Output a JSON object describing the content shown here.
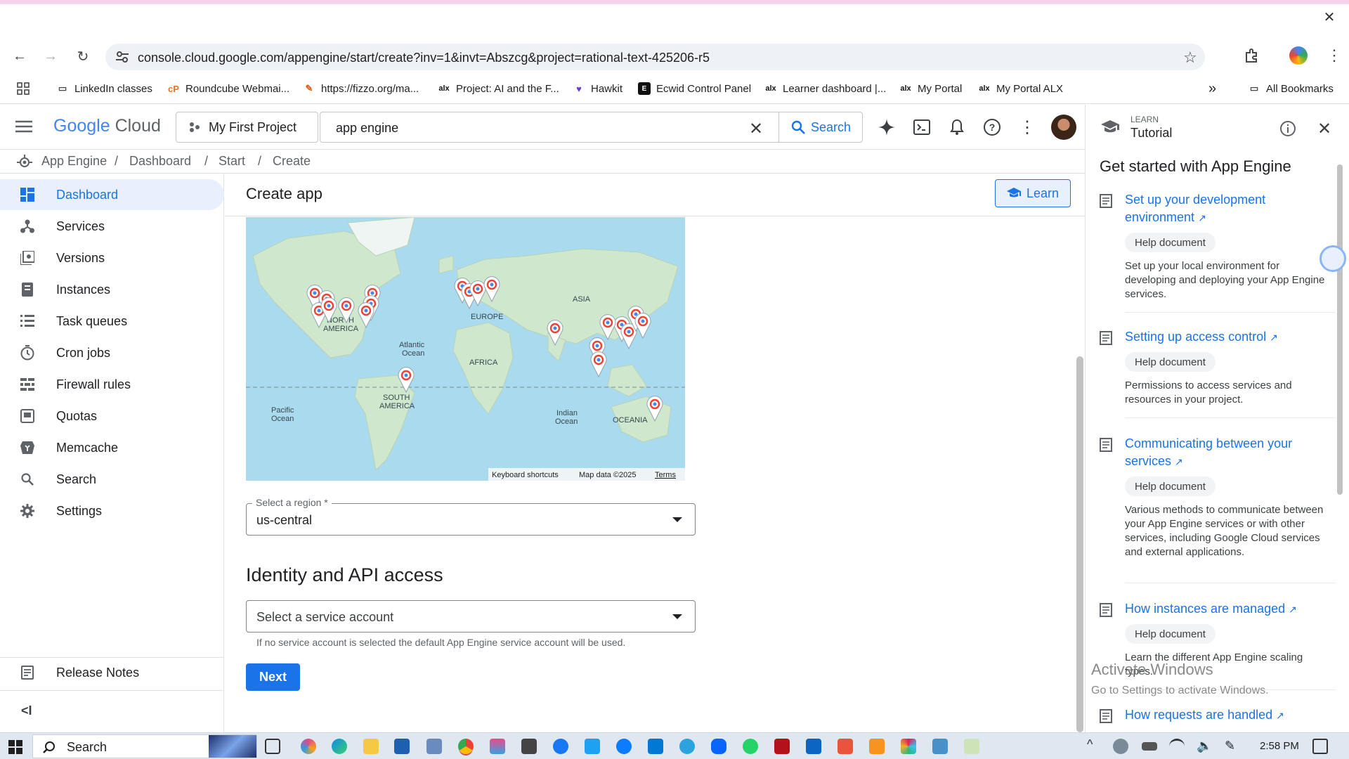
{
  "browser": {
    "url": "console.cloud.google.com/appengine/start/create?inv=1&invt=Abszcg&project=rational-text-425206-r5",
    "bookmarks": [
      {
        "label": "LinkedIn classes",
        "icon": "folder-icon"
      },
      {
        "label": "Roundcube Webmai...",
        "icon": "roundcube-icon"
      },
      {
        "label": "https://fizzo.org/ma...",
        "icon": "fizzo-icon"
      },
      {
        "label": "Project: AI and the F...",
        "icon": "alx-icon"
      },
      {
        "label": "Hawkit",
        "icon": "hawkit-icon"
      },
      {
        "label": "Ecwid Control Panel",
        "icon": "ecwid-icon"
      },
      {
        "label": "Learner dashboard |...",
        "icon": "alx-icon"
      },
      {
        "label": "My Portal",
        "icon": "alx-icon"
      },
      {
        "label": "My Portal ALX",
        "icon": "alx-icon"
      }
    ],
    "all_bookmarks": "All Bookmarks",
    "overflow": "»"
  },
  "header": {
    "logo_google": "Google",
    "logo_cloud": "Cloud",
    "project": "My First Project",
    "search_value": "app engine",
    "search_button": "Search"
  },
  "breadcrumb": {
    "items": [
      "App Engine",
      "Dashboard",
      "Start",
      "Create"
    ],
    "separator": "/"
  },
  "sidebar": {
    "items": [
      {
        "label": "Dashboard",
        "icon": "dashboard-icon",
        "active": true
      },
      {
        "label": "Services",
        "icon": "services-icon"
      },
      {
        "label": "Versions",
        "icon": "versions-icon"
      },
      {
        "label": "Instances",
        "icon": "instances-icon"
      },
      {
        "label": "Task queues",
        "icon": "task-queues-icon"
      },
      {
        "label": "Cron jobs",
        "icon": "cron-jobs-icon"
      },
      {
        "label": "Firewall rules",
        "icon": "firewall-icon"
      },
      {
        "label": "Quotas",
        "icon": "quotas-icon"
      },
      {
        "label": "Memcache",
        "icon": "memcache-icon"
      },
      {
        "label": "Search",
        "icon": "search-icon"
      },
      {
        "label": "Settings",
        "icon": "settings-icon"
      }
    ],
    "release_notes": "Release Notes",
    "collapse": "<I"
  },
  "main": {
    "title": "Create app",
    "learn_button": "Learn",
    "map": {
      "labels": {
        "north_america_1": "NORTH",
        "north_america_2": "AMERICA",
        "europe": "EUROPE",
        "asia": "ASIA",
        "africa": "AFRICA",
        "atlantic_1": "Atlantic",
        "atlantic_2": "Ocean",
        "south_america_1": "SOUTH",
        "south_america_2": "AMERICA",
        "pacific_1": "Pacific",
        "pacific_2": "Ocean",
        "indian_1": "Indian",
        "indian_2": "Ocean",
        "oceania": "OCEANIA"
      },
      "attribution": {
        "shortcuts": "Keyboard shortcuts",
        "map_data": "Map data ©2025",
        "terms": "Terms"
      }
    },
    "region": {
      "label": "Select a region *",
      "value": "us-central"
    },
    "identity_heading": "Identity and API access",
    "service_account": {
      "placeholder": "Select a service account",
      "hint": "If no service account is selected the default App Engine service account will be used."
    },
    "next_button": "Next"
  },
  "tutorial": {
    "eyebrow": "LEARN",
    "title": "Tutorial",
    "heading": "Get started with App Engine",
    "items": [
      {
        "title": "Set up your development environment",
        "chip": "Help document",
        "description": "Set up your local environment for developing and deploying your App Engine services."
      },
      {
        "title": "Setting up access control",
        "chip": "Help document",
        "description": "Permissions to access services and resources in your project."
      },
      {
        "title": "Communicating between your services",
        "chip": "Help document",
        "description": "Various methods to communicate between your App Engine services or with other services, including Google Cloud services and external applications."
      },
      {
        "title": "How instances are managed",
        "chip": "Help document",
        "description": "Learn the different App Engine scaling types."
      },
      {
        "title": "How requests are handled",
        "chip": "",
        "description": ""
      }
    ]
  },
  "watermark": {
    "line1": "Activate Windows",
    "line2": "Go to Settings to activate Windows."
  },
  "taskbar": {
    "search": "Search",
    "time": "2:58 PM"
  },
  "colors": {
    "accent": "#1a73e8",
    "active_nav_bg": "#e8f0fe",
    "map_water": "#aadaed",
    "map_land": "#cfe9cf",
    "pin_red": "#ea4335",
    "pin_blue": "#4285f4"
  }
}
